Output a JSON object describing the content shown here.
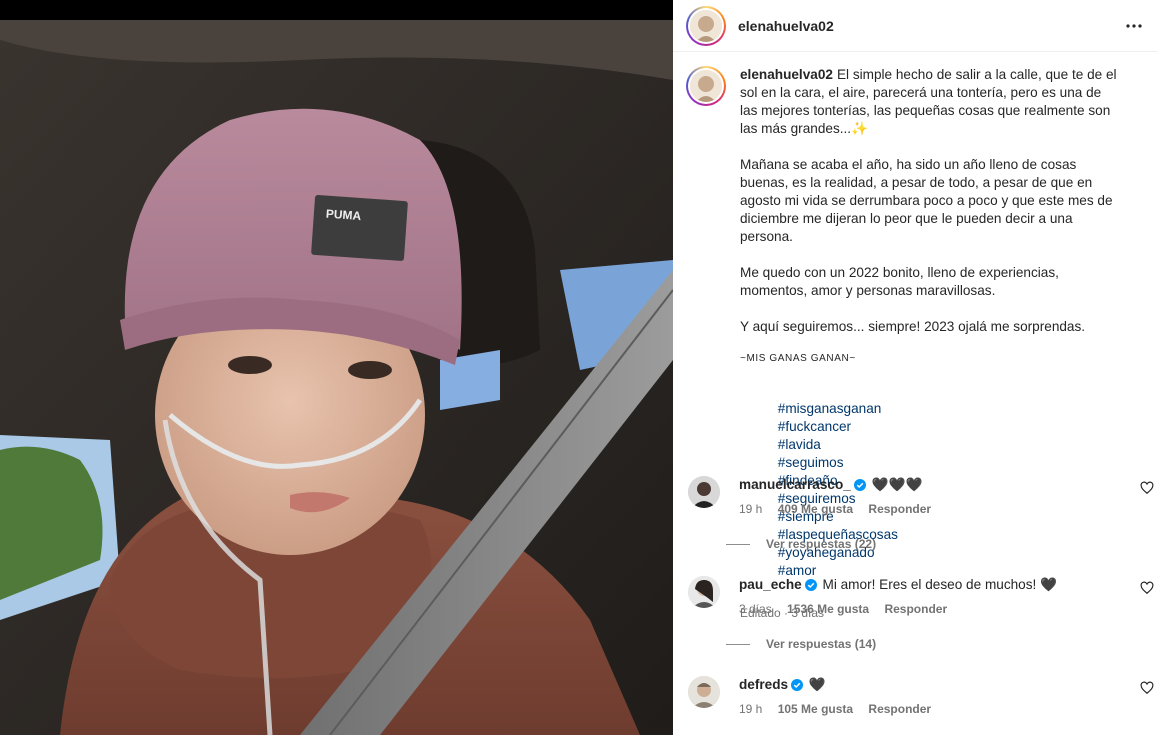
{
  "post": {
    "username": "elenahuelva02",
    "caption": {
      "paragraph1": "El simple hecho de salir a la calle, que te de el sol en la cara, el aire, parecerá una tontería, pero es una de las mejores tonterías, las pequeñas cosas que realmente son las más grandes...✨",
      "paragraph2": "Mañana se acaba el año, ha sido un año lleno de cosas buenas, es la realidad, a pesar de todo, a pesar de que en agosto mi vida se derrumbara poco a poco y que este mes de diciembre me dijeran lo peor que le pueden decir a una persona.",
      "paragraph3": "Me quedo con un 2022 bonito, lleno de experiencias, momentos, amor y personas maravillosas.",
      "paragraph4": "Y aquí seguiremos... siempre! 2023 ojalá me sorprendas.",
      "small_caps": "~MIS GANAS GANAN~",
      "hashtags": [
        "#misganasganan",
        "#fuckcancer",
        "#lavida",
        "#seguimos",
        "#findeaño",
        "#seguiremos",
        "#siempre",
        "#laspequeñascosas",
        "#yoyaheganado",
        "#amor"
      ]
    },
    "edited": "Editado · 3 días"
  },
  "comments": [
    {
      "username": "manuelcarrasco_",
      "verified": true,
      "text": "🖤🖤🖤",
      "time": "19 h",
      "likes": "409 Me gusta",
      "reply": "Responder",
      "view_replies": "Ver respuestas (22)"
    },
    {
      "username": "pau_eche",
      "verified": true,
      "text": "Mi amor! Eres el deseo de muchos! 🖤",
      "time": "3 días",
      "likes": "1536 Me gusta",
      "reply": "Responder",
      "view_replies": "Ver respuestas (14)"
    },
    {
      "username": "defreds",
      "verified": true,
      "text": "🖤",
      "time": "19 h",
      "likes": "105 Me gusta",
      "reply": "Responder"
    }
  ],
  "colors": {
    "link": "#00376b",
    "verified": "#0095f6",
    "muted": "#737373"
  },
  "icons": {
    "more": "more-horizontal-icon",
    "like": "heart-outline-icon",
    "verified": "verified-badge-icon"
  }
}
